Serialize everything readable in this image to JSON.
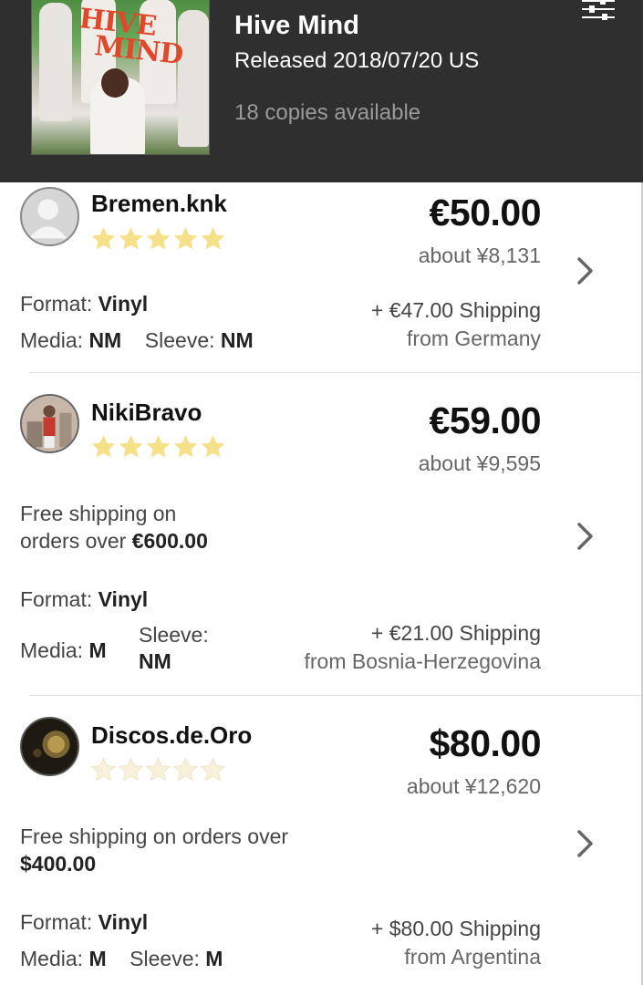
{
  "header": {
    "album_title": "Hive Mind",
    "release": "Released 2018/07/20 US",
    "copies": "18 copies available",
    "cover_text_line1": "HIVE",
    "cover_text_line2": "MIND",
    "filter_icon": "sliders-icon",
    "background_color": "#2f2f2f"
  },
  "listings": [
    {
      "seller": "Bremen.knk",
      "rating_stars": 5,
      "price": "€50.00",
      "approx": "about ¥8,131",
      "format_label": "Format:",
      "format_value": "Vinyl",
      "media_label": "Media:",
      "media_value": "NM",
      "sleeve_label": "Sleeve:",
      "sleeve_value": "NM",
      "shipping": "+ €47.00 Shipping",
      "from": "from Germany"
    },
    {
      "seller": "NikiBravo",
      "rating_stars": 5,
      "price": "€59.00",
      "approx": "about ¥9,595",
      "free_ship_text": "Free shipping on",
      "free_ship_text2": "orders over",
      "free_ship_amount": "€600.00",
      "format_label": "Format:",
      "format_value": "Vinyl",
      "media_label": "Media:",
      "media_value": "M",
      "sleeve_label": "Sleeve:",
      "sleeve_value": "NM",
      "shipping": "+ €21.00 Shipping",
      "from": "from Bosnia-Herzegovina"
    },
    {
      "seller": "Discos.de.Oro",
      "rating_stars": 0,
      "price": "$80.00",
      "approx": "about ¥12,620",
      "free_ship_text": "Free shipping on orders over",
      "free_ship_amount": "$400.00",
      "format_label": "Format:",
      "format_value": "Vinyl",
      "media_label": "Media:",
      "media_value": "M",
      "sleeve_label": "Sleeve:",
      "sleeve_value": "M",
      "shipping": "+ $80.00 Shipping",
      "from": "from Argentina"
    }
  ],
  "colors": {
    "star_filled": "#f6e08a",
    "star_empty": "#f7f1dc",
    "chevron": "#666666"
  }
}
